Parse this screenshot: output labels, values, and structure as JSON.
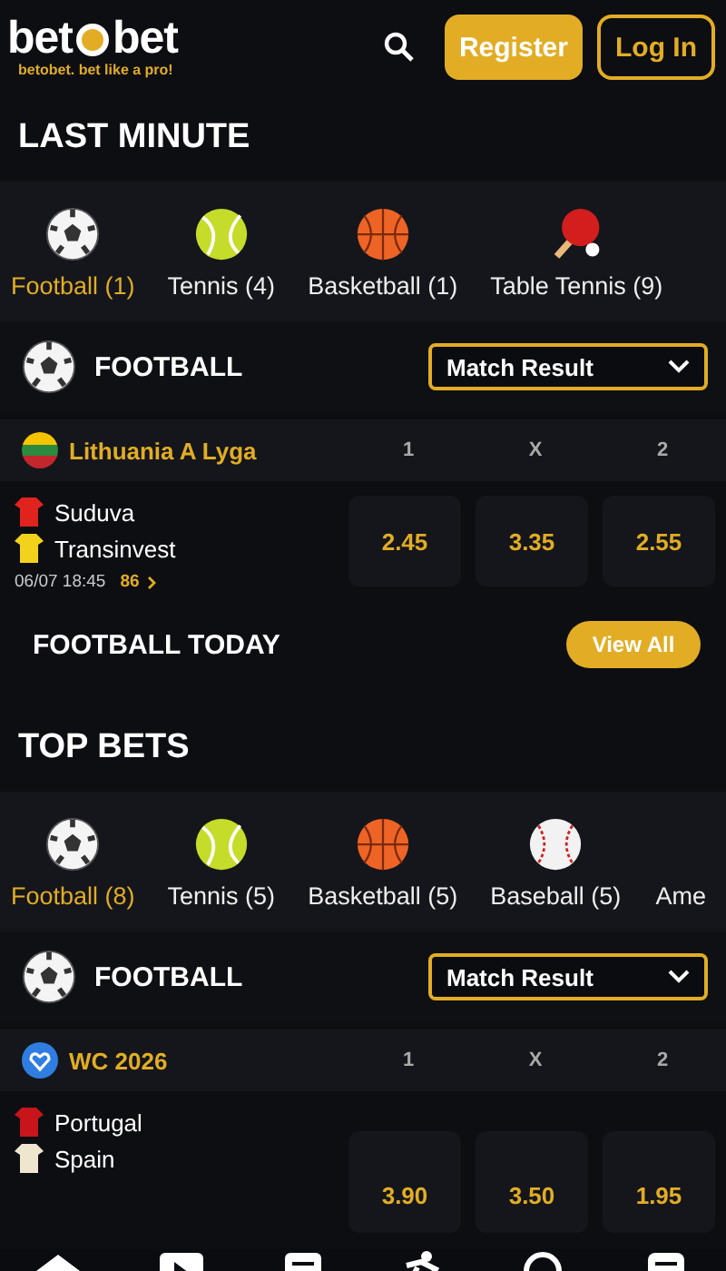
{
  "header": {
    "logo_left": "bet",
    "logo_right": "bet",
    "tagline": "betobet. bet like a pro!",
    "buttons": [
      {
        "label": "Register",
        "kind": "filled"
      },
      {
        "label": "Log In",
        "kind": "outline"
      }
    ]
  },
  "sections": [
    {
      "title": "LAST MINUTE",
      "sports": [
        {
          "kind": "football",
          "label": "Football (1)",
          "selected": true
        },
        {
          "kind": "tennis",
          "label": "Tennis (4)",
          "selected": false
        },
        {
          "kind": "basketball",
          "label": "Basketball (1)",
          "selected": false
        },
        {
          "kind": "table-tennis",
          "label": "Table Tennis (9)",
          "selected": false
        }
      ],
      "market": {
        "sport": "FOOTBALL",
        "dropdown": "Match Result"
      },
      "league": {
        "name": "Lithuania A Lyga",
        "kind": "flag",
        "columns": [
          "1",
          "X",
          "2"
        ]
      },
      "match": {
        "teams": [
          {
            "name": "Suduva",
            "color": "#e0231c"
          },
          {
            "name": "Transinvest",
            "color": "#f2d21b"
          }
        ],
        "date": "06/07 18:45",
        "more": "86",
        "odds": [
          "2.45",
          "3.35",
          "2.55"
        ]
      },
      "footer": {
        "title": "FOOTBALL TODAY",
        "button": "View All"
      }
    },
    {
      "title": "TOP BETS",
      "sports": [
        {
          "kind": "football",
          "label": "Football (8)",
          "selected": true
        },
        {
          "kind": "tennis",
          "label": "Tennis (5)",
          "selected": false
        },
        {
          "kind": "basketball",
          "label": "Basketball (5)",
          "selected": false
        },
        {
          "kind": "baseball",
          "label": "Baseball (5)",
          "selected": false
        },
        {
          "kind": "hidden",
          "label": "Ame",
          "selected": false
        }
      ],
      "market": {
        "sport": "FOOTBALL",
        "dropdown": "Match Result"
      },
      "league": {
        "name": "WC 2026",
        "kind": "tournament",
        "columns": [
          "1",
          "X",
          "2"
        ]
      },
      "match": {
        "teams": [
          {
            "name": "Portugal",
            "color": "#c8151b"
          },
          {
            "name": "Spain",
            "color": "#efe6cf"
          }
        ],
        "odds": [
          "3.90",
          "3.50",
          "1.95"
        ]
      }
    }
  ],
  "nav": [
    {
      "kind": "home"
    },
    {
      "kind": "play"
    },
    {
      "kind": "list"
    },
    {
      "kind": "figure"
    },
    {
      "kind": "search"
    },
    {
      "kind": "slip"
    }
  ]
}
